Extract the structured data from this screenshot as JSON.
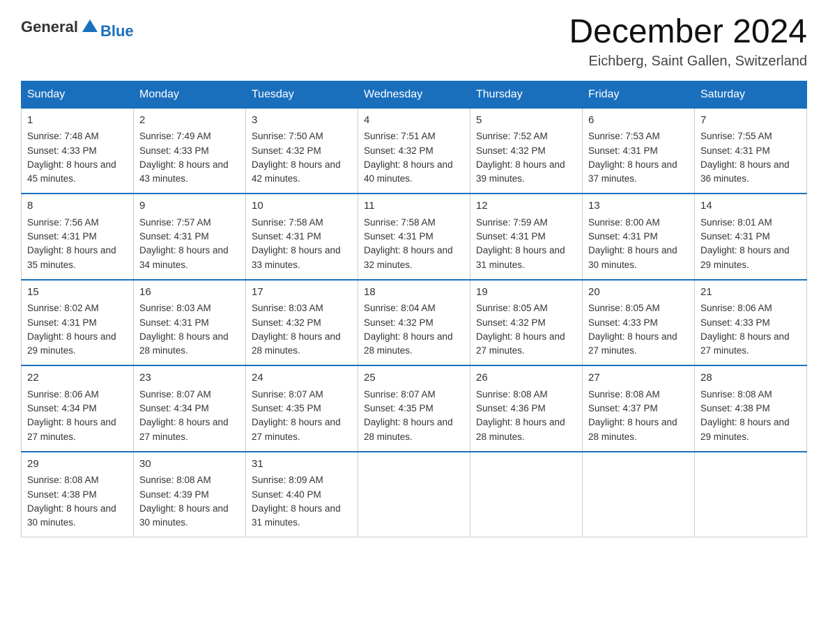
{
  "logo": {
    "text_general": "General",
    "text_blue": "Blue"
  },
  "title": "December 2024",
  "location": "Eichberg, Saint Gallen, Switzerland",
  "days_of_week": [
    "Sunday",
    "Monday",
    "Tuesday",
    "Wednesday",
    "Thursday",
    "Friday",
    "Saturday"
  ],
  "weeks": [
    [
      {
        "day": "1",
        "sunrise": "7:48 AM",
        "sunset": "4:33 PM",
        "daylight": "8 hours and 45 minutes."
      },
      {
        "day": "2",
        "sunrise": "7:49 AM",
        "sunset": "4:33 PM",
        "daylight": "8 hours and 43 minutes."
      },
      {
        "day": "3",
        "sunrise": "7:50 AM",
        "sunset": "4:32 PM",
        "daylight": "8 hours and 42 minutes."
      },
      {
        "day": "4",
        "sunrise": "7:51 AM",
        "sunset": "4:32 PM",
        "daylight": "8 hours and 40 minutes."
      },
      {
        "day": "5",
        "sunrise": "7:52 AM",
        "sunset": "4:32 PM",
        "daylight": "8 hours and 39 minutes."
      },
      {
        "day": "6",
        "sunrise": "7:53 AM",
        "sunset": "4:31 PM",
        "daylight": "8 hours and 37 minutes."
      },
      {
        "day": "7",
        "sunrise": "7:55 AM",
        "sunset": "4:31 PM",
        "daylight": "8 hours and 36 minutes."
      }
    ],
    [
      {
        "day": "8",
        "sunrise": "7:56 AM",
        "sunset": "4:31 PM",
        "daylight": "8 hours and 35 minutes."
      },
      {
        "day": "9",
        "sunrise": "7:57 AM",
        "sunset": "4:31 PM",
        "daylight": "8 hours and 34 minutes."
      },
      {
        "day": "10",
        "sunrise": "7:58 AM",
        "sunset": "4:31 PM",
        "daylight": "8 hours and 33 minutes."
      },
      {
        "day": "11",
        "sunrise": "7:58 AM",
        "sunset": "4:31 PM",
        "daylight": "8 hours and 32 minutes."
      },
      {
        "day": "12",
        "sunrise": "7:59 AM",
        "sunset": "4:31 PM",
        "daylight": "8 hours and 31 minutes."
      },
      {
        "day": "13",
        "sunrise": "8:00 AM",
        "sunset": "4:31 PM",
        "daylight": "8 hours and 30 minutes."
      },
      {
        "day": "14",
        "sunrise": "8:01 AM",
        "sunset": "4:31 PM",
        "daylight": "8 hours and 29 minutes."
      }
    ],
    [
      {
        "day": "15",
        "sunrise": "8:02 AM",
        "sunset": "4:31 PM",
        "daylight": "8 hours and 29 minutes."
      },
      {
        "day": "16",
        "sunrise": "8:03 AM",
        "sunset": "4:31 PM",
        "daylight": "8 hours and 28 minutes."
      },
      {
        "day": "17",
        "sunrise": "8:03 AM",
        "sunset": "4:32 PM",
        "daylight": "8 hours and 28 minutes."
      },
      {
        "day": "18",
        "sunrise": "8:04 AM",
        "sunset": "4:32 PM",
        "daylight": "8 hours and 28 minutes."
      },
      {
        "day": "19",
        "sunrise": "8:05 AM",
        "sunset": "4:32 PM",
        "daylight": "8 hours and 27 minutes."
      },
      {
        "day": "20",
        "sunrise": "8:05 AM",
        "sunset": "4:33 PM",
        "daylight": "8 hours and 27 minutes."
      },
      {
        "day": "21",
        "sunrise": "8:06 AM",
        "sunset": "4:33 PM",
        "daylight": "8 hours and 27 minutes."
      }
    ],
    [
      {
        "day": "22",
        "sunrise": "8:06 AM",
        "sunset": "4:34 PM",
        "daylight": "8 hours and 27 minutes."
      },
      {
        "day": "23",
        "sunrise": "8:07 AM",
        "sunset": "4:34 PM",
        "daylight": "8 hours and 27 minutes."
      },
      {
        "day": "24",
        "sunrise": "8:07 AM",
        "sunset": "4:35 PM",
        "daylight": "8 hours and 27 minutes."
      },
      {
        "day": "25",
        "sunrise": "8:07 AM",
        "sunset": "4:35 PM",
        "daylight": "8 hours and 28 minutes."
      },
      {
        "day": "26",
        "sunrise": "8:08 AM",
        "sunset": "4:36 PM",
        "daylight": "8 hours and 28 minutes."
      },
      {
        "day": "27",
        "sunrise": "8:08 AM",
        "sunset": "4:37 PM",
        "daylight": "8 hours and 28 minutes."
      },
      {
        "day": "28",
        "sunrise": "8:08 AM",
        "sunset": "4:38 PM",
        "daylight": "8 hours and 29 minutes."
      }
    ],
    [
      {
        "day": "29",
        "sunrise": "8:08 AM",
        "sunset": "4:38 PM",
        "daylight": "8 hours and 30 minutes."
      },
      {
        "day": "30",
        "sunrise": "8:08 AM",
        "sunset": "4:39 PM",
        "daylight": "8 hours and 30 minutes."
      },
      {
        "day": "31",
        "sunrise": "8:09 AM",
        "sunset": "4:40 PM",
        "daylight": "8 hours and 31 minutes."
      },
      null,
      null,
      null,
      null
    ]
  ]
}
